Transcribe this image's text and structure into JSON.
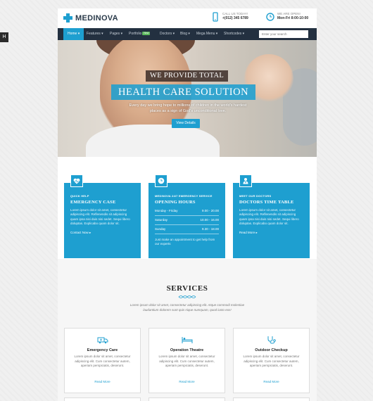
{
  "colors": {
    "accent": "#1e9fd0",
    "nav_bg": "#233040",
    "badge": "#5cb85c"
  },
  "side_tab": {
    "icon": "settings-icon",
    "label": "H"
  },
  "header": {
    "logo_text": "MEDINOVA",
    "phone_label": "CALL US TODAY!",
    "phone": "+(012) 345 6789",
    "hours_label": "WE ARE OPEN!",
    "hours": "Mon-Fri 8:00-10:00"
  },
  "nav": {
    "items": [
      {
        "label": "Home ▾",
        "active": true
      },
      {
        "label": "Features ▾"
      },
      {
        "label": "Pages ▾"
      },
      {
        "label": "Portfolio",
        "badge": "New"
      },
      {
        "label": "Doctors ▾"
      },
      {
        "label": "Blog ▾"
      },
      {
        "label": "Mega Menu ▾"
      },
      {
        "label": "Shortcodes ▾"
      }
    ],
    "search_placeholder": "Enter your search"
  },
  "hero": {
    "tagline": "WE PROVIDE TOTAL",
    "title": "HEALTH CARE SOLUTION",
    "subtitle": "Every day we bring hope to millions of children in the world's hardest places as a sign of God's unconditional love.",
    "button": "View Details"
  },
  "info_boxes": [
    {
      "kicker": "QUICK HELP",
      "title": "EMERGENCY CASE",
      "text": "Lorem ipsum dolor sit amet, consectetur adipiscing elit. Reflenendis sit adipiscing quam ipsa nisi duis nisi sedet. Sequi libero doluptas. Explicabo quam dolor sit.",
      "link": "Contact Now ▸",
      "icon": "heart-monitor-icon"
    },
    {
      "kicker": "MEDINOVA 24/7 EMERGENCY SERVICE",
      "title": "OPENING HOURS",
      "rows": [
        {
          "day": "Monday - Friday",
          "time": "9.00 - 20.00"
        },
        {
          "day": "Saturday",
          "time": "10.00 - 16.00"
        },
        {
          "day": "Sunday",
          "time": "9.30 - 18.00"
        }
      ],
      "note": "Just make an appointment to get help from our experts",
      "icon": "clock-icon"
    },
    {
      "kicker": "MEET OUR DOCTORS",
      "title": "DOCTORS TIME TABLE",
      "text": "Lorem ipsum dolor sit amet, consectetur adipiscing elit. Reflenendis sit adipiscing quam ipsa nisi duis nisi sedet. Sequi libero doluptas. Explicabo quam dolor sit.",
      "link": "Read More ▸",
      "icon": "doctor-icon"
    }
  ],
  "services": {
    "title": "SERVICES",
    "intro": "Lorem ipsum dolor sit amet, consectetur adipiscing elit. Atque commodi molestiae laudantium dolorem sunt quis nique numquam, quod iusto eos!",
    "cards": [
      {
        "title": "Emergency Care",
        "text": "Lorem ipsum dolor sit amet, consectetur adipiscing elit. Cum consectetur autem, aperiam perspiciatis, deserunt.",
        "link": "Read More",
        "icon": "ambulance-icon"
      },
      {
        "title": "Operation Theatre",
        "text": "Lorem ipsum dolor sit amet, consectetur adipiscing elit. Cum consectetur autem, aperiam perspiciatis, deserunt.",
        "link": "Read More",
        "icon": "bed-icon"
      },
      {
        "title": "Outdoor Checkup",
        "text": "Lorem ipsum dolor sit amet, consectetur adipiscing elit. Cum consectetur autem, aperiam perspiciatis, deserunt.",
        "link": "Read More",
        "icon": "stethoscope-icon"
      }
    ]
  }
}
